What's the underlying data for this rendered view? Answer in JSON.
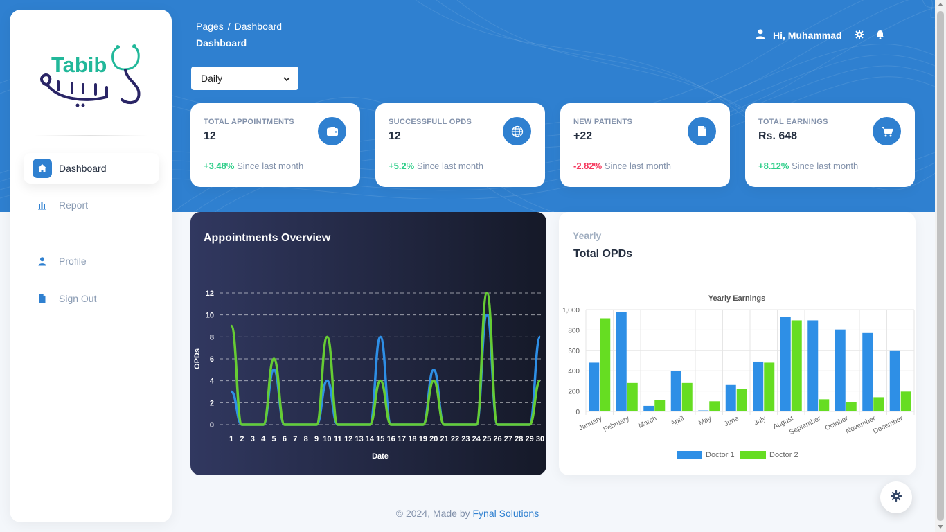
{
  "brand": {
    "name": "Tabib"
  },
  "sidebar": {
    "items": [
      {
        "label": "Dashboard",
        "icon": "home-icon",
        "active": true
      },
      {
        "label": "Report",
        "icon": "bar-chart-icon",
        "active": false
      },
      {
        "label": "Profile",
        "icon": "user-icon",
        "active": false
      },
      {
        "label": "Sign Out",
        "icon": "document-icon",
        "active": false
      }
    ]
  },
  "header": {
    "breadcrumb": [
      "Pages",
      "Dashboard"
    ],
    "breadcrumb_sep": "/",
    "title": "Dashboard",
    "greeting": "Hi, Muhammad"
  },
  "filter": {
    "selected": "Daily"
  },
  "stats": [
    {
      "label": "TOTAL APPOINTMENTS",
      "value": "12",
      "change": "+3.48%",
      "trend": "up",
      "note": "Since last month",
      "icon": "wallet-icon"
    },
    {
      "label": "SUCCESSFULL OPDS",
      "value": "12",
      "change": "+5.2%",
      "trend": "up",
      "note": "Since last month",
      "icon": "globe-icon"
    },
    {
      "label": "NEW PATIENTS",
      "value": "+22",
      "change": "-2.82%",
      "trend": "down",
      "note": "Since last month",
      "icon": "file-icon"
    },
    {
      "label": "TOTAL EARNINGS",
      "value": "Rs. 648",
      "change": "+8.12%",
      "trend": "up",
      "note": "Since last month",
      "icon": "cart-icon"
    }
  ],
  "appointments": {
    "title": "Appointments Overview"
  },
  "opds": {
    "subtitle": "Yearly",
    "title": "Total OPDs"
  },
  "footer": {
    "prefix": "© 2024, Made by",
    "link": "Fynal Solutions"
  },
  "colors": {
    "accent": "#2f80d0",
    "blue_series": "#2e8fe6",
    "green_series": "#66dd22",
    "positive": "#2dce89",
    "negative": "#f5365c"
  },
  "chart_data": [
    {
      "type": "line",
      "title": "",
      "xlabel": "Date",
      "ylabel": "OPDs",
      "ylim": [
        0,
        12
      ],
      "yticks": [
        0,
        2,
        4,
        6,
        8,
        10,
        12
      ],
      "grid": true,
      "x": [
        1,
        2,
        3,
        4,
        5,
        6,
        7,
        8,
        9,
        10,
        11,
        12,
        13,
        14,
        15,
        16,
        17,
        18,
        19,
        20,
        21,
        22,
        23,
        24,
        25,
        26,
        27,
        28,
        29,
        30
      ],
      "series": [
        {
          "color": "#2e8fe6",
          "values": [
            3,
            0,
            0,
            0,
            5,
            0,
            0,
            0,
            0,
            4,
            0,
            0,
            0,
            0,
            8,
            0,
            0,
            0,
            0,
            5,
            0,
            0,
            0,
            0,
            10,
            0,
            0,
            0,
            0,
            8
          ]
        },
        {
          "color": "#66cc33",
          "values": [
            9,
            0,
            0,
            0,
            6,
            0,
            0,
            0,
            0,
            8,
            0,
            0,
            0,
            0,
            4,
            0,
            0,
            0,
            0,
            4,
            0,
            0,
            0,
            0,
            12,
            0,
            0,
            0,
            0,
            4
          ]
        }
      ]
    },
    {
      "type": "bar",
      "title": "Yearly Earnings",
      "categories": [
        "January",
        "February",
        "March",
        "April",
        "May",
        "June",
        "July",
        "August",
        "September",
        "October",
        "November",
        "December"
      ],
      "ylim": [
        0,
        1000
      ],
      "yticks": [
        0,
        200,
        400,
        600,
        800,
        1000
      ],
      "ytick_labels": [
        "0",
        "200",
        "400",
        "600",
        "800",
        "1,000"
      ],
      "legend": "bottom",
      "series": [
        {
          "name": "Doctor 1",
          "color": "#2e8fe6",
          "values": [
            480,
            975,
            55,
            395,
            10,
            260,
            490,
            930,
            895,
            805,
            770,
            600
          ]
        },
        {
          "name": "Doctor 2",
          "color": "#66dd22",
          "values": [
            915,
            280,
            110,
            280,
            100,
            220,
            480,
            895,
            120,
            95,
            140,
            195
          ]
        }
      ]
    }
  ]
}
